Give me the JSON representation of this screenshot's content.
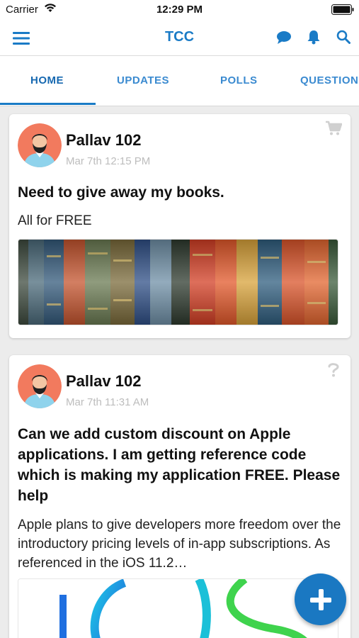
{
  "status_bar": {
    "carrier": "Carrier",
    "time": "12:29 PM"
  },
  "nav": {
    "title": "TCC",
    "icons": [
      "menu-icon",
      "chat-icon",
      "bell-icon",
      "search-icon"
    ]
  },
  "tabs": [
    {
      "label": "HOME",
      "active": true
    },
    {
      "label": "UPDATES",
      "active": false
    },
    {
      "label": "POLLS",
      "active": false
    },
    {
      "label": "QUESTION",
      "active": false
    }
  ],
  "posts": [
    {
      "author": "Pallav 102",
      "timestamp": "Mar 7th 12:15 PM",
      "title": "Need to give away my books.",
      "body": "All for FREE",
      "corner_icon": "cart-icon",
      "image": "books-image"
    },
    {
      "author": "Pallav 102",
      "timestamp": "Mar 7th 11:31 AM",
      "title": "Can we add custom discount on Apple applications. I am getting reference code which is making my application FREE. Please help",
      "body": "Apple plans to give developers more freedom over the introductory pricing levels of in-app subscriptions. As referenced in the iOS 11.2…",
      "corner_icon": "question-icon",
      "image": "ios-logo-image"
    }
  ],
  "fab": {
    "icon": "plus-icon"
  },
  "colors": {
    "brand_blue": "#1a7bc6",
    "background": "#ececec",
    "timestamp_gray": "#bdbdbd",
    "avatar_bg": "#f27a5e"
  }
}
